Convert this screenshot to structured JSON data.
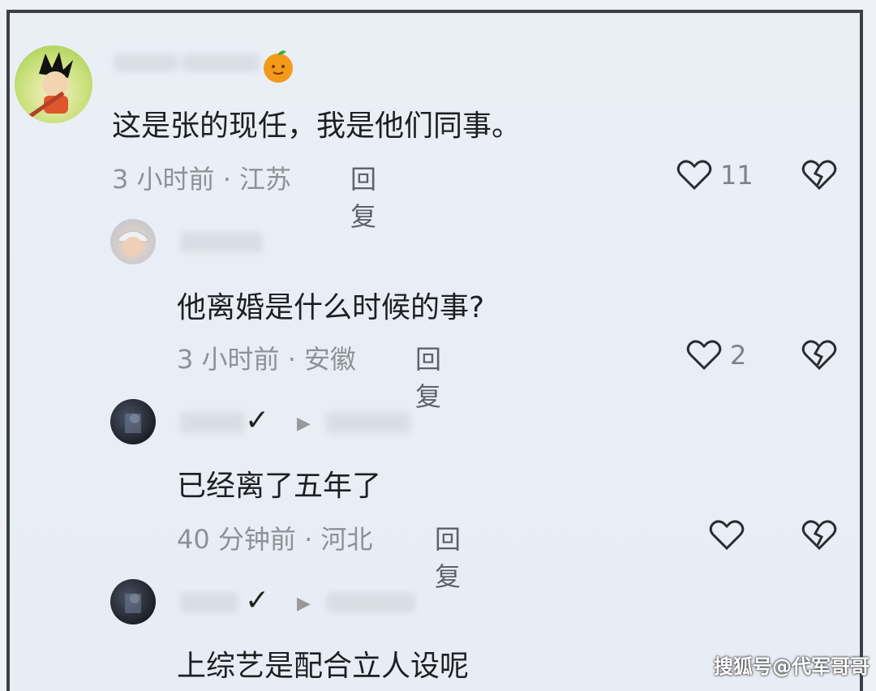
{
  "comments": [
    {
      "text": "这是张的现任，我是他们同事。",
      "time": "3 小时前 · 江苏",
      "reply": "回复",
      "likes": "11"
    },
    {
      "text": "他离婚是什么时候的事?",
      "time": "3 小时前 · 安徽",
      "reply": "回复",
      "likes": "2"
    },
    {
      "text": "已经离了五年了",
      "time": "40 分钟前 · 河北",
      "reply": "回复",
      "likes": ""
    },
    {
      "text": "上综艺是配合立人设呢"
    }
  ],
  "watermark": "搜狐号@代军哥哥",
  "colors": {
    "background": "#eaeff6",
    "meta_text": "#8e9196",
    "content_text": "#1e1f23"
  }
}
